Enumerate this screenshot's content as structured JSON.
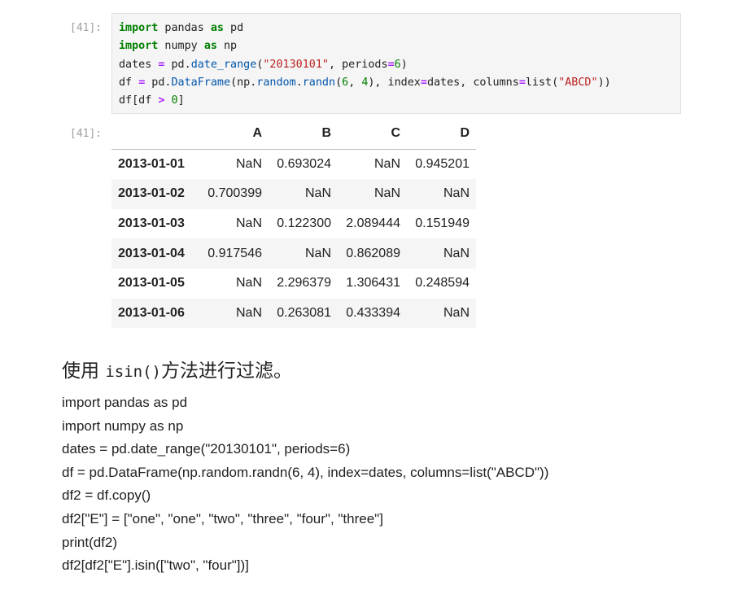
{
  "input_cell": {
    "prompt": "[41]:",
    "lines": [
      [
        {
          "t": "import",
          "c": "kw"
        },
        {
          "t": " pandas ",
          "c": ""
        },
        {
          "t": "as",
          "c": "kw"
        },
        {
          "t": " pd",
          "c": ""
        }
      ],
      [
        {
          "t": "import",
          "c": "kw"
        },
        {
          "t": " numpy ",
          "c": ""
        },
        {
          "t": "as",
          "c": "kw"
        },
        {
          "t": " np",
          "c": ""
        }
      ],
      [
        {
          "t": "dates ",
          "c": ""
        },
        {
          "t": "=",
          "c": "op"
        },
        {
          "t": " pd.",
          "c": ""
        },
        {
          "t": "date_range",
          "c": "attr"
        },
        {
          "t": "(",
          "c": ""
        },
        {
          "t": "\"20130101\"",
          "c": "str"
        },
        {
          "t": ", periods",
          "c": ""
        },
        {
          "t": "=",
          "c": "op"
        },
        {
          "t": "6",
          "c": "num"
        },
        {
          "t": ")",
          "c": ""
        }
      ],
      [
        {
          "t": "df ",
          "c": ""
        },
        {
          "t": "=",
          "c": "op"
        },
        {
          "t": " pd.",
          "c": ""
        },
        {
          "t": "DataFrame",
          "c": "attr"
        },
        {
          "t": "(np.",
          "c": ""
        },
        {
          "t": "random",
          "c": "attr"
        },
        {
          "t": ".",
          "c": ""
        },
        {
          "t": "randn",
          "c": "attr"
        },
        {
          "t": "(",
          "c": ""
        },
        {
          "t": "6",
          "c": "num"
        },
        {
          "t": ", ",
          "c": ""
        },
        {
          "t": "4",
          "c": "num"
        },
        {
          "t": "), index",
          "c": ""
        },
        {
          "t": "=",
          "c": "op"
        },
        {
          "t": "dates, columns",
          "c": ""
        },
        {
          "t": "=",
          "c": "op"
        },
        {
          "t": "list(",
          "c": ""
        },
        {
          "t": "\"ABCD\"",
          "c": "str"
        },
        {
          "t": "))",
          "c": ""
        }
      ],
      [
        {
          "t": "df[df ",
          "c": ""
        },
        {
          "t": ">",
          "c": "op"
        },
        {
          "t": " ",
          "c": ""
        },
        {
          "t": "0",
          "c": "num"
        },
        {
          "t": "]",
          "c": ""
        }
      ]
    ]
  },
  "output_cell": {
    "prompt": "[41]:",
    "columns": [
      "A",
      "B",
      "C",
      "D"
    ],
    "rows": [
      {
        "index": "2013-01-01",
        "values": [
          "NaN",
          "0.693024",
          "NaN",
          "0.945201"
        ]
      },
      {
        "index": "2013-01-02",
        "values": [
          "0.700399",
          "NaN",
          "NaN",
          "NaN"
        ]
      },
      {
        "index": "2013-01-03",
        "values": [
          "NaN",
          "0.122300",
          "2.089444",
          "0.151949"
        ]
      },
      {
        "index": "2013-01-04",
        "values": [
          "0.917546",
          "NaN",
          "0.862089",
          "NaN"
        ]
      },
      {
        "index": "2013-01-05",
        "values": [
          "NaN",
          "2.296379",
          "1.306431",
          "0.248594"
        ]
      },
      {
        "index": "2013-01-06",
        "values": [
          "NaN",
          "0.263081",
          "0.433394",
          "NaN"
        ]
      }
    ]
  },
  "markdown": {
    "heading_prefix": "使用 ",
    "heading_code": "isin()",
    "heading_suffix": "方法进行过滤。",
    "code_lines": [
      "import pandas as pd",
      "import numpy as np",
      "dates = pd.date_range(\"20130101\", periods=6)",
      "df = pd.DataFrame(np.random.randn(6, 4), index=dates, columns=list(\"ABCD\"))",
      "df2 = df.copy()",
      "df2[\"E\"] = [\"one\", \"one\", \"two\", \"three\", \"four\", \"three\"]",
      "print(df2)",
      "df2[df2[\"E\"].isin([\"two\", \"four\"])]"
    ]
  }
}
